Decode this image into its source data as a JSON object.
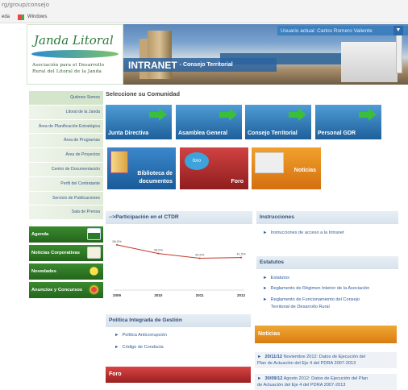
{
  "browser": {
    "url": "rg/group/consejo",
    "fav_prefix": "eda",
    "fav_windows": "Windows"
  },
  "logo": {
    "title": "Janda Litoral",
    "sub1": "Asociación para el Desarrollo",
    "sub2": "Rural del Litoral de la Janda"
  },
  "banner": {
    "intranet": "INTRANET",
    "intranet_sub": "- Consejo Territorial",
    "user": "Usuario actual: Carlos Romero Valiente"
  },
  "left_nav": {
    "items": [
      "Quiénes Somos",
      "Litoral de la Janda",
      "Área de Planificación Estratégica",
      "Área de Programas",
      "Área de Proyectos",
      "Centro de Documentación",
      "Perfil del Contratante",
      "Servicio de Publicaciones",
      "Sala de Prensa"
    ]
  },
  "green_nav": {
    "items": [
      "Agenda",
      "Noticias Corporativas",
      "Novedades",
      "Anuncios y Concursos"
    ]
  },
  "main": {
    "title": "Seleccione su Comunidad",
    "tiles": [
      "Junta Directiva",
      "Asamblea General",
      "Consejo Territorial",
      "Personal GDR"
    ],
    "tiles2": {
      "bib1": "Biblioteca de",
      "bib2": "documentos",
      "foro": "Foro",
      "noticias": "Noticias",
      "foro_bubble": "foro"
    }
  },
  "participacion": {
    "header": "-->Participación en el CTDR"
  },
  "chart_data": {
    "type": "line",
    "title": "",
    "categories": [
      "2009",
      "2010",
      "2011",
      "2012"
    ],
    "values": [
      58.5,
      46.9,
      40.5,
      41.5
    ],
    "data_labels": [
      "58,5%",
      "46,9%",
      "40,5%",
      "41,5%"
    ],
    "ylim": [
      0,
      80
    ],
    "grid": false,
    "color": "#c0392b"
  },
  "instrucciones": {
    "header": "Instrucciones",
    "link": "Instrucciones de acceso a la Intranet"
  },
  "estatutos": {
    "header": "Estatutos",
    "links": [
      "Estatutos",
      "Reglamento de Régimen Interior de la Asociación",
      "Reglamento de Funcionamiento del Consejo",
      "Territorial de Desarrollo Rural"
    ]
  },
  "politica": {
    "header": "Política Integrada de Gestión",
    "links": [
      "Política Anticorrupción",
      "Código de Conducta"
    ]
  },
  "noticias": {
    "header": "Noticias",
    "items": [
      {
        "date": "20/11/12",
        "line1": "Noviembre 2012: Datos de Ejecución del",
        "line2": "Plan de Actuación del Eje 4 del PDRA 2007-2013"
      },
      {
        "date": "30/09/12",
        "line1": "Agosto 2012: Datos de Ejecución del Plan",
        "line2": "de Actuación del Eje 4 del PDRA 2007-2013"
      }
    ]
  },
  "foro": {
    "header": "Foro"
  },
  "colors": {
    "green": "#2d7a3a",
    "blue": "#1e5f9a",
    "red": "#c0392b",
    "orange": "#e28a1d"
  }
}
